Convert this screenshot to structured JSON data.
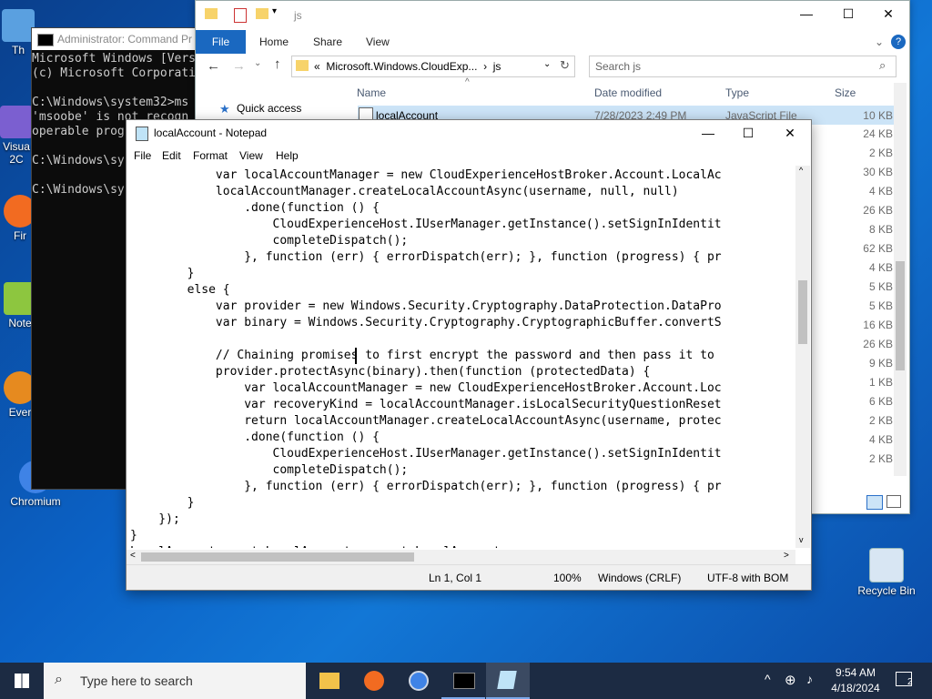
{
  "desktop": {
    "icons": [
      {
        "label": "Th",
        "icon": "this-pc-icon"
      },
      {
        "label": "Visua\n2C",
        "icon": "visual-studio-icon"
      },
      {
        "label": "Fir",
        "icon": "firefox-icon"
      },
      {
        "label": "Note",
        "icon": "notepad-plus-icon"
      },
      {
        "label": "Ever",
        "icon": "everything-icon"
      },
      {
        "label": "Chromium",
        "icon": "chromium-icon"
      },
      {
        "label": "Recycle Bin",
        "icon": "recycle-bin-icon"
      }
    ]
  },
  "cmd": {
    "title": "Administrator: Command Pr",
    "lines": [
      "Microsoft Windows [Vers",
      "(c) Microsoft Corporati",
      "",
      "C:\\Windows\\system32>ms",
      "'msoobe' is not recogn",
      "operable prog",
      "",
      "C:\\Windows\\sy",
      "",
      "C:\\Windows\\sy"
    ]
  },
  "explorer": {
    "title": "js",
    "ribbon": {
      "file": "File",
      "home": "Home",
      "share": "Share",
      "view": "View"
    },
    "address": "«  Microsoft.Windows.CloudExp...  ›  js",
    "search_placeholder": "Search js",
    "nav": {
      "quick_access": "Quick access"
    },
    "columns": {
      "name": "Name",
      "date": "Date modified",
      "type": "Type",
      "size": "Size"
    },
    "first_file": {
      "name": "localAccount",
      "date": "7/28/2023 2:49 PM",
      "type": "JavaScript File",
      "size": "10 KB"
    },
    "sizes": [
      "24 KB",
      "2 KB",
      "30 KB",
      "4 KB",
      "26 KB",
      "8 KB",
      "62 KB",
      "4 KB",
      "5 KB",
      "5 KB",
      "16 KB",
      "26 KB",
      "9 KB",
      "1 KB",
      "6 KB",
      "2 KB",
      "4 KB",
      "2 KB"
    ]
  },
  "notepad": {
    "title": "localAccount - Notepad",
    "menu": {
      "file": "File",
      "edit": "Edit",
      "format": "Format",
      "view": "View",
      "help": "Help"
    },
    "code": "            var localAccountManager = new CloudExperienceHostBroker.Account.LocalAc\n            localAccountManager.createLocalAccountAsync(username, null, null)\n                .done(function () {\n                    CloudExperienceHost.IUserManager.getInstance().setSignInIdentit\n                    completeDispatch();\n                }, function (err) { errorDispatch(err); }, function (progress) { pr\n        }\n        else {\n            var provider = new Windows.Security.Cryptography.DataProtection.DataPro\n            var binary = Windows.Security.Cryptography.CryptographicBuffer.convertS\n\n            // Chaining promises to first encrypt the password and then pass it to\n            provider.protectAsync(binary).then(function (protectedData) {\n                var localAccountManager = new CloudExperienceHostBroker.Account.Loc\n                var recoveryKind = localAccountManager.isLocalSecurityQuestionReset\n                return localAccountManager.createLocalAccountAsync(username, protec\n                .done(function () {\n                    CloudExperienceHost.IUserManager.getInstance().setSignInIdentit\n                    completeDispatch();\n                }, function (err) { errorDispatch(err); }, function (progress) { pr\n        }\n    });\n}\nLocalAccount.createLocalAccount = createLocalAccount;",
    "status": {
      "position": "Ln 1, Col 1",
      "zoom": "100%",
      "eol": "Windows (CRLF)",
      "encoding": "UTF-8 with BOM"
    }
  },
  "taskbar": {
    "search_placeholder": "Type here to search",
    "time": "9:54 AM",
    "date": "4/18/2024",
    "notification_count": "2"
  }
}
